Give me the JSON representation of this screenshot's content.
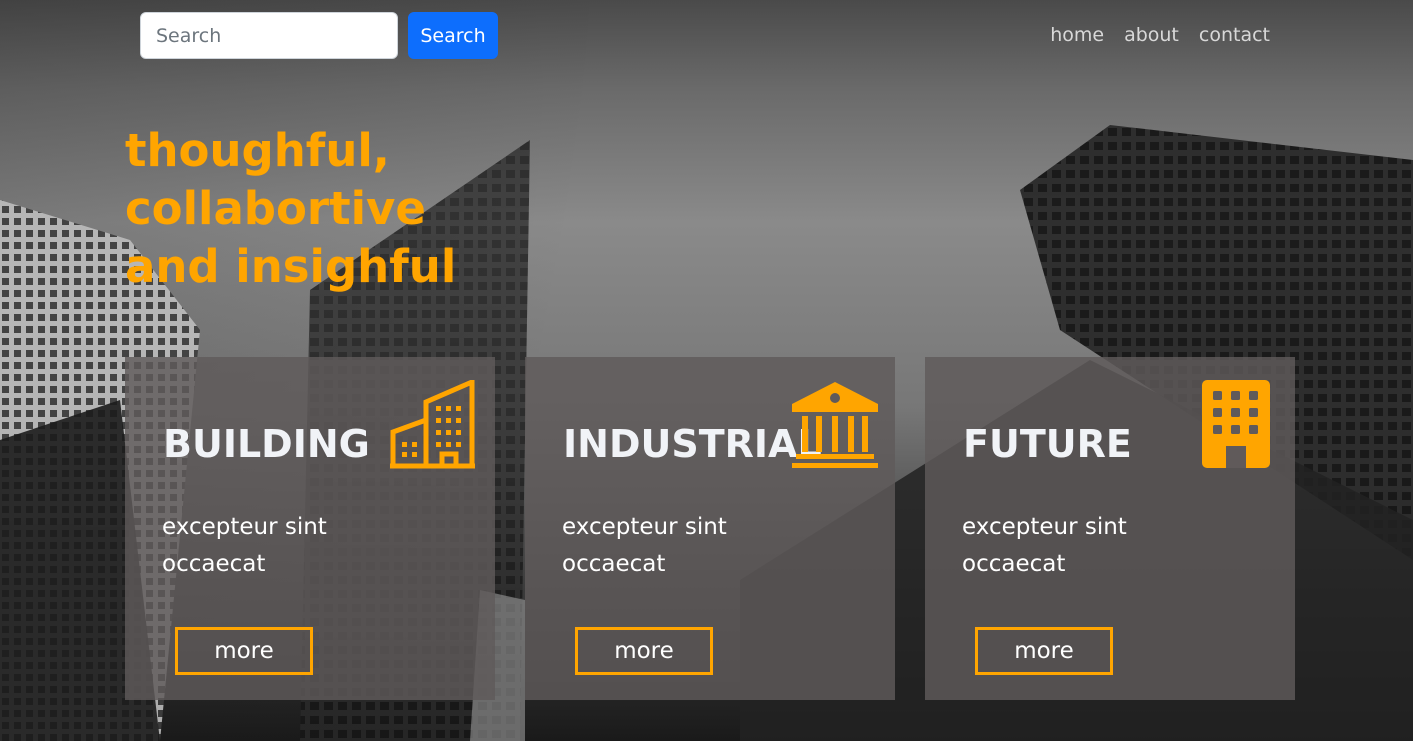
{
  "header": {
    "search_placeholder": "Search",
    "search_button_label": "Search",
    "nav": [
      {
        "label": "home"
      },
      {
        "label": "about"
      },
      {
        "label": "contact"
      }
    ]
  },
  "hero": {
    "title": "thoughful, collabortive and insighful"
  },
  "cards": [
    {
      "title": "BUILDING",
      "icon": "city-buildings-icon",
      "text": "excepteur sint occaecat",
      "button": "more"
    },
    {
      "title": "INDUSTRIAL",
      "icon": "bank-building-icon",
      "text": "excepteur sint occaecat",
      "button": "more"
    },
    {
      "title": "FUTURE",
      "icon": "office-building-icon",
      "text": "excepteur sint occaecat",
      "button": "more"
    }
  ],
  "colors": {
    "accent": "#ffa500",
    "primary_button": "#0d6efd",
    "card_background": "rgba(95,90,90,0.82)"
  }
}
